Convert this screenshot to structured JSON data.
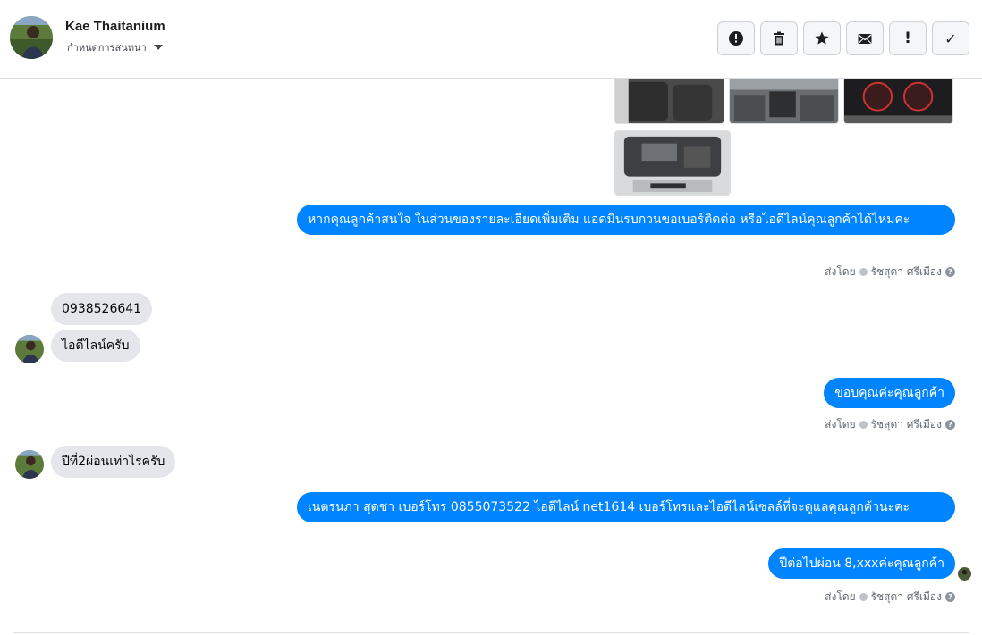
{
  "header": {
    "contact_name": "Kae Thaitanium",
    "assign_label": "กำหนดการสนทนา",
    "toolbar": [
      {
        "name": "report-spam-button",
        "icon": "alert-circle-icon",
        "glyph": ""
      },
      {
        "name": "delete-button",
        "icon": "trash-icon",
        "glyph": ""
      },
      {
        "name": "star-button",
        "icon": "star-icon",
        "glyph": ""
      },
      {
        "name": "mark-unread-button",
        "icon": "envelope-icon",
        "glyph": ""
      },
      {
        "name": "follow-up-button",
        "icon": "exclamation-icon",
        "glyph": "!"
      },
      {
        "name": "mark-done-button",
        "icon": "check-icon",
        "glyph": "✓"
      }
    ]
  },
  "messages": {
    "m1_out": "หากคุณลูกค้าสนใจ ในส่วนของรายละเอียดเพิ่มเติม แอดมินรบกวนขอเบอร์ติดต่อ หรือไอดีไลน์คุณลูกค้าได้ไหมคะ",
    "m2_in": "0938526641",
    "m3_in": "ไอดีไลน์ครับ",
    "m4_out": "ขอบคุณค่ะคุณลูกค้า",
    "m5_in": "ปีที่2ผ่อนเท่าไรครับ",
    "m6_out": "เนตรนภา สุดชา      เบอร์โทร 0855073522  ไอดีไลน์ net1614  เบอร์โทรและไอดีไลน์เซลล์ที่จะดูแลคุณลูกค้านะคะ",
    "m7_out": "ปีต่อไปผ่อน 8,xxxค่ะคุณลูกค้า"
  },
  "sent_by": {
    "label": "ส่งโดย",
    "agent": "รัชสุดา ศรีเมือง"
  },
  "colors": {
    "outgoing_bubble": "#0084ff",
    "incoming_bubble": "#e4e6eb"
  }
}
